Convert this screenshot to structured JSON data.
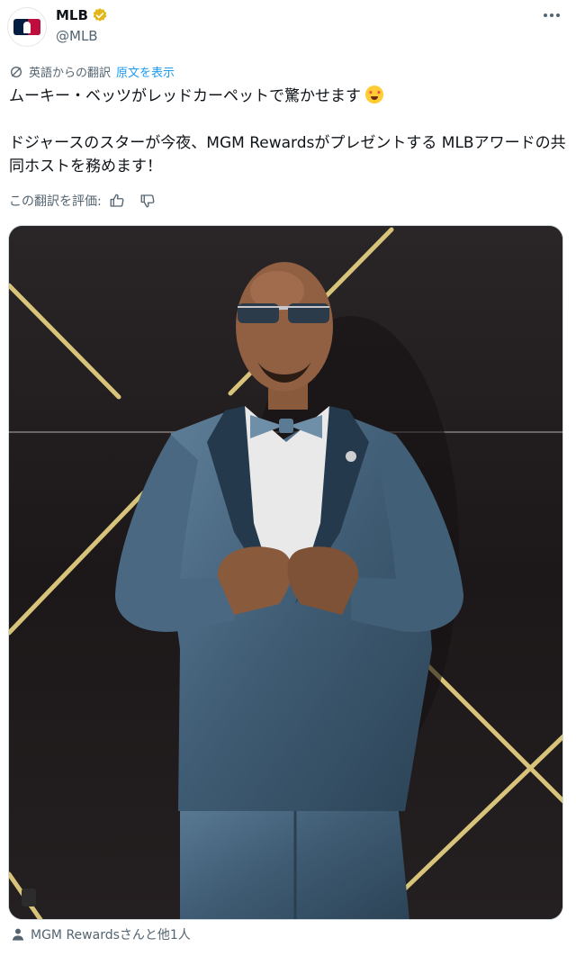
{
  "author": {
    "display_name": "MLB",
    "handle": "@MLB",
    "verified_color": "#e2b719",
    "avatar_icon": "mlb-logo-icon"
  },
  "translation": {
    "notice": "英語からの翻訳",
    "show_original": "原文を表示"
  },
  "tweet": {
    "line1": "ムーキー・ベッツがレッドカーペットで驚かせます",
    "line1_emoji": "star-struck-emoji",
    "line2": "ドジャースのスターが今夜、MGM Rewardsがプレゼントする MLBアワードの共同ホストを務めます！"
  },
  "rating": {
    "label": "この翻訳を評価:",
    "up_icon": "thumbs-up-icon",
    "down_icon": "thumbs-down-icon"
  },
  "media": {
    "description_icon": "photo"
  },
  "footer": {
    "tagged": "MGM Rewardsさんと他1人",
    "icon": "person-icon"
  }
}
